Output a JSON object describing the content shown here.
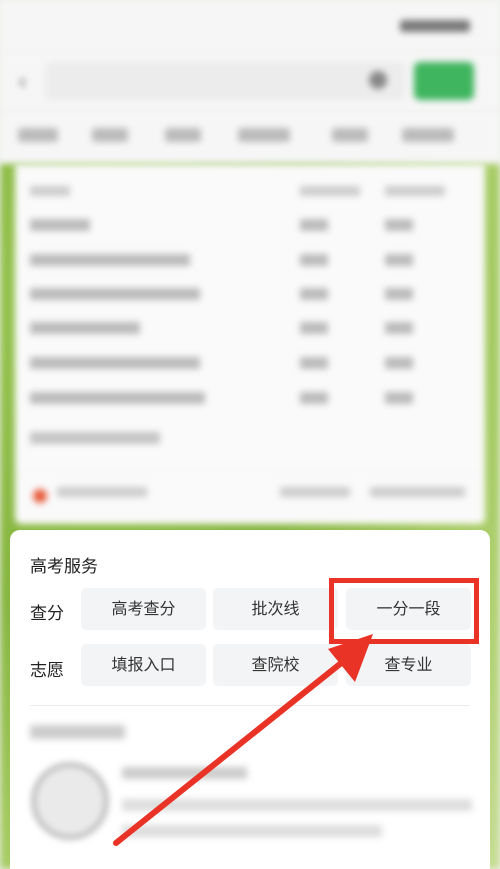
{
  "service": {
    "title": "高考服务",
    "score_label": "查分",
    "score_items": [
      "高考查分",
      "批次线",
      "一分一段"
    ],
    "volunteer_label": "志愿",
    "volunteer_items": [
      "填报入口",
      "查院校",
      "查专业"
    ]
  },
  "annotation": {
    "highlight_color": "#e83326",
    "highlighted_item": "一分一段"
  },
  "colors": {
    "accent_green": "#3fb55f",
    "background_green": "#86b540"
  },
  "icons": [
    "back-icon",
    "clear-icon",
    "logo-icon"
  ]
}
